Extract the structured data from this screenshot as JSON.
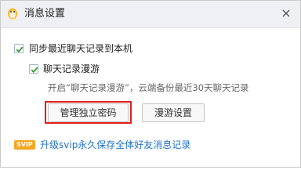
{
  "window": {
    "title": "消息设置",
    "title_icon": "penguin-settings-icon",
    "close_icon": "close-icon"
  },
  "sync": {
    "label": "同步最近聊天记录到本机",
    "checked": true
  },
  "roaming": {
    "label": "聊天记录漫游",
    "checked": true,
    "description": "开启“聊天记录漫游”，云端备份最近30天聊天记录"
  },
  "buttons": {
    "manage_password": "管理独立密码",
    "roaming_settings": "漫游设置"
  },
  "svip": {
    "badge": "SVIP",
    "link_text": "升级svip永久保存全体好友消息记录"
  },
  "colors": {
    "highlight": "#e0201c",
    "link": "#1f73c9",
    "check": "#2e9a2e",
    "badge": "#f5a623"
  }
}
